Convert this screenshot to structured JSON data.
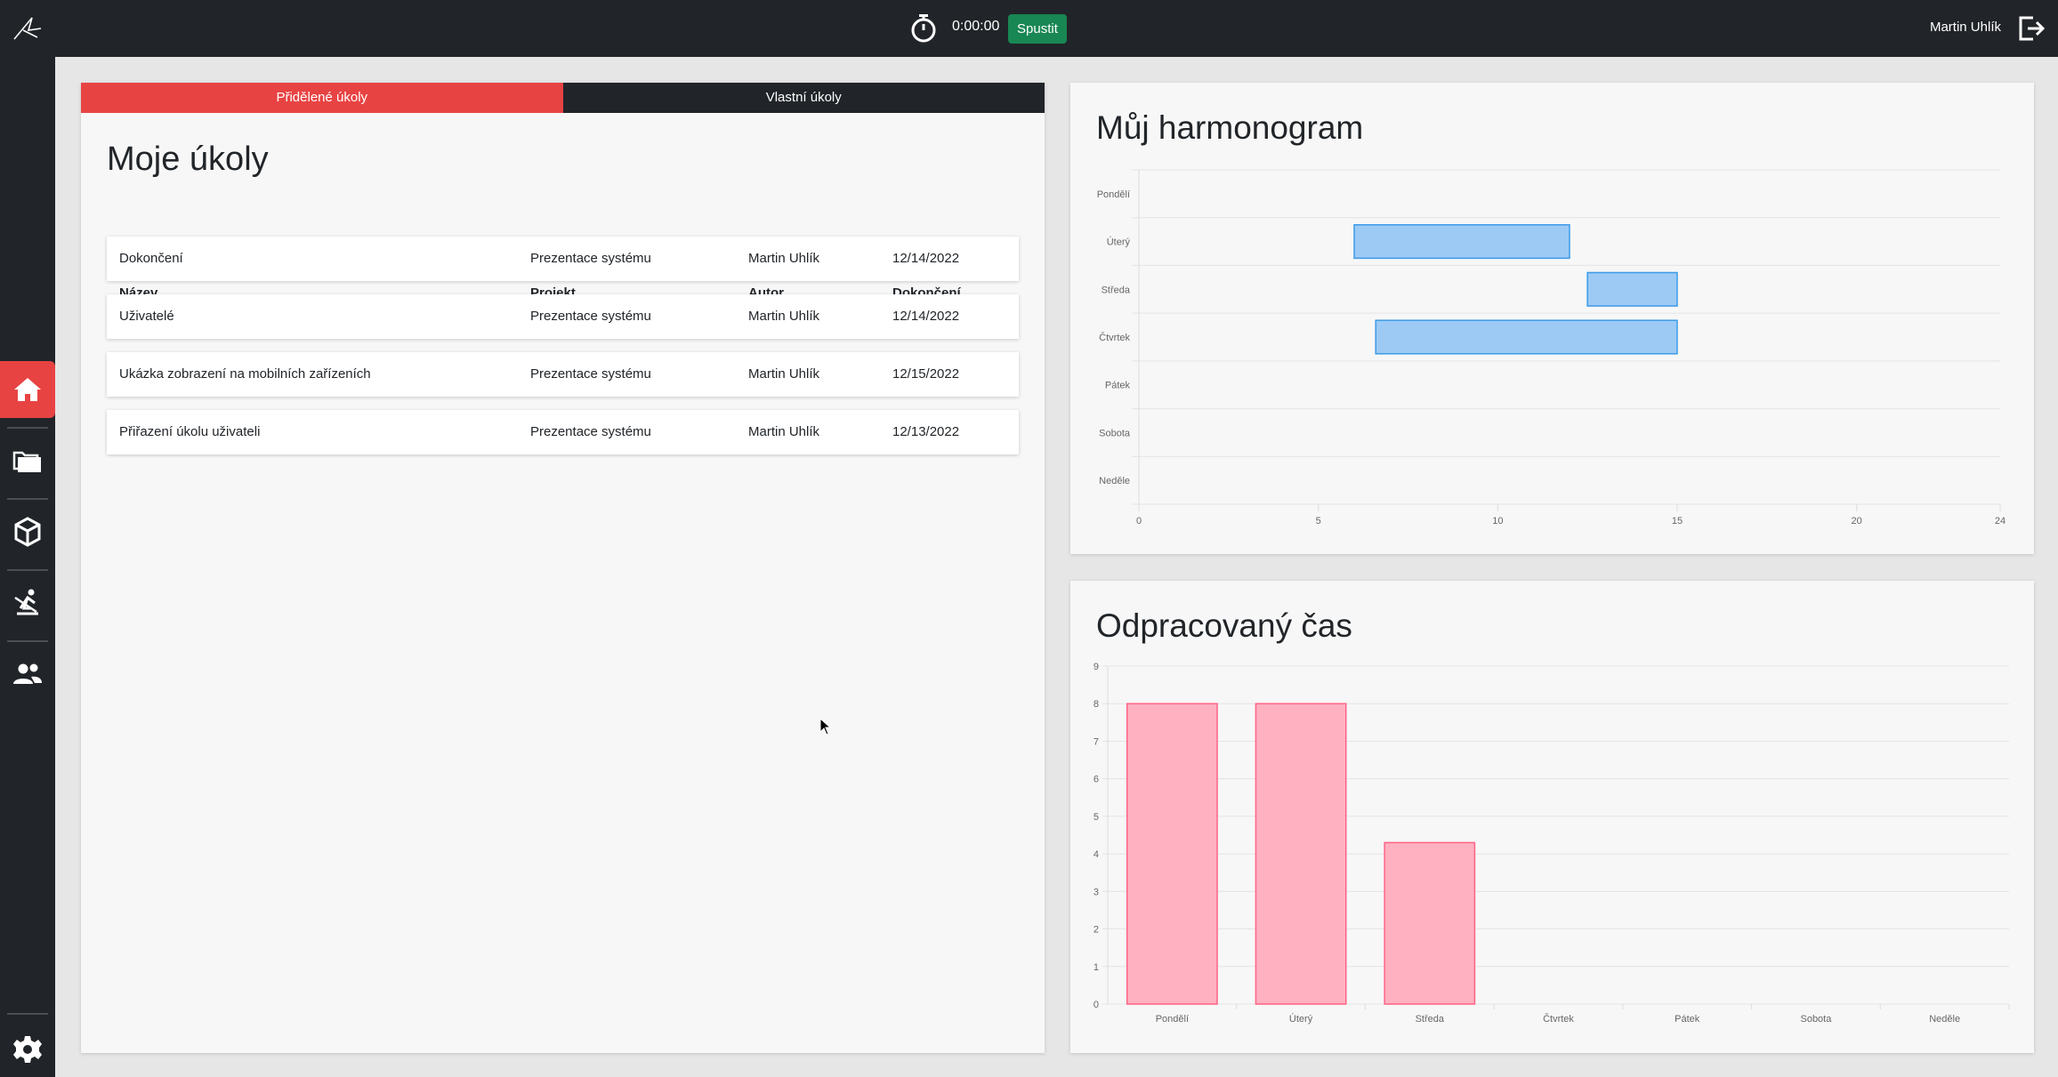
{
  "topbar": {
    "timer": "0:00:00",
    "start_label": "Spustit",
    "user_name": "Martin Uhlík"
  },
  "tabs": [
    {
      "label": "Přidělené úkoly",
      "active": true
    },
    {
      "label": "Vlastní úkoly",
      "active": false
    }
  ],
  "tasks": {
    "title": "Moje úkoly",
    "columns": [
      "Název",
      "Projekt",
      "Autor",
      "Dokončení"
    ],
    "rows": [
      [
        "Dokončení",
        "Prezentace systému",
        "Martin Uhlík",
        "12/14/2022"
      ],
      [
        "Uživatelé",
        "Prezentace systému",
        "Martin Uhlík",
        "12/14/2022"
      ],
      [
        "Ukázka zobrazení na mobilních zařízeních",
        "Prezentace systému",
        "Martin Uhlík",
        "12/15/2022"
      ],
      [
        "Přiřazení úkolu uživateli",
        "Prezentace systému",
        "Martin Uhlík",
        "12/13/2022"
      ]
    ]
  },
  "sidebar": {
    "items": [
      "home-icon",
      "folder-icon",
      "box-icon",
      "rowing-icon",
      "users-icon"
    ],
    "bottom": "gear-icon",
    "active_index": 0
  },
  "colors": {
    "accent": "#e84343",
    "dark": "#212529",
    "success": "#198754",
    "gantt_fill": "#9ccaf5",
    "gantt_stroke": "#3d9be6",
    "bar_fill": "#ffb1c1",
    "bar_stroke": "#ff6384"
  },
  "chart_data": [
    {
      "type": "bar",
      "title": "Můj harmonogram",
      "orientation": "horizontal-floating",
      "categories": [
        "Pondělí",
        "Úterý",
        "Středa",
        "Čtvrtek",
        "Pátek",
        "Sobota",
        "Neděle"
      ],
      "ranges": [
        null,
        [
          6,
          12
        ],
        [
          12.5,
          15
        ],
        [
          6.6,
          15
        ],
        null,
        null,
        null
      ],
      "xlim": [
        0,
        24
      ],
      "xticks": [
        "0",
        "5",
        "10",
        "15",
        "20",
        "24"
      ],
      "xtick_values": [
        0,
        5,
        10,
        15,
        20,
        24
      ],
      "grid": true
    },
    {
      "type": "bar",
      "title": "Odpracovaný čas",
      "categories": [
        "Pondělí",
        "Úterý",
        "Středa",
        "Čtvrtek",
        "Pátek",
        "Sobota",
        "Neděle"
      ],
      "values": [
        8,
        8,
        4.3,
        0,
        0,
        0,
        0
      ],
      "ylim": [
        0,
        9
      ],
      "yticks": [
        "0",
        "1",
        "2",
        "3",
        "4",
        "5",
        "6",
        "7",
        "8",
        "9"
      ],
      "grid": true
    }
  ]
}
